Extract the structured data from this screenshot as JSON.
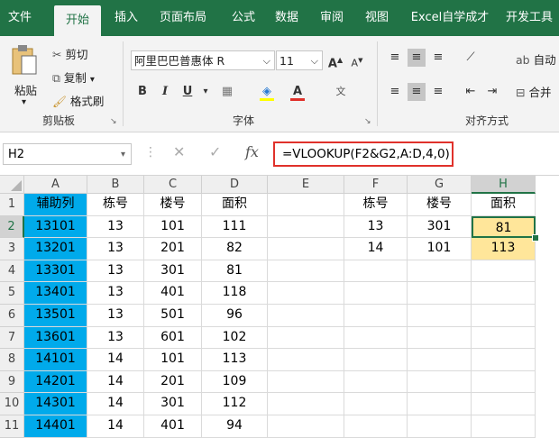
{
  "ribbon_tabs": [
    "文件",
    "开始",
    "插入",
    "页面布局",
    "公式",
    "数据",
    "审阅",
    "视图",
    "Excel自学成才",
    "开发工具"
  ],
  "active_tab": "开始",
  "clipboard": {
    "paste": "粘贴",
    "cut": "剪切",
    "copy": "复制",
    "format_painter": "格式刷",
    "group_label": "剪贴板"
  },
  "font": {
    "name": "阿里巴巴普惠体 R",
    "size": "11",
    "grow": "A",
    "shrink": "A",
    "bold": "B",
    "italic": "I",
    "underline": "U",
    "group_label": "字体"
  },
  "alignment": {
    "wrap_label": "自动",
    "merge_label": "合并",
    "group_label": "对齐方式"
  },
  "formula_bar": {
    "name_box": "H2",
    "fx": "fx",
    "formula": "=VLOOKUP(F2&G2,A:D,4,0)"
  },
  "sheet": {
    "columns": [
      "A",
      "B",
      "C",
      "D",
      "E",
      "F",
      "G",
      "H"
    ],
    "rows": [
      "1",
      "2",
      "3",
      "4",
      "5",
      "6",
      "7",
      "8",
      "9",
      "10",
      "11"
    ],
    "cells": [
      [
        "辅助列",
        "栋号",
        "楼号",
        "面积",
        "",
        "栋号",
        "楼号",
        "面积"
      ],
      [
        "13101",
        "13",
        "101",
        "111",
        "",
        "13",
        "301",
        "81"
      ],
      [
        "13201",
        "13",
        "201",
        "82",
        "",
        "14",
        "101",
        "113"
      ],
      [
        "13301",
        "13",
        "301",
        "81",
        "",
        "",
        "",
        ""
      ],
      [
        "13401",
        "13",
        "401",
        "118",
        "",
        "",
        "",
        ""
      ],
      [
        "13501",
        "13",
        "501",
        "96",
        "",
        "",
        "",
        ""
      ],
      [
        "13601",
        "13",
        "601",
        "102",
        "",
        "",
        "",
        ""
      ],
      [
        "14101",
        "14",
        "101",
        "113",
        "",
        "",
        "",
        ""
      ],
      [
        "14201",
        "14",
        "201",
        "109",
        "",
        "",
        "",
        ""
      ],
      [
        "14301",
        "14",
        "301",
        "112",
        "",
        "",
        "",
        ""
      ],
      [
        "14401",
        "14",
        "401",
        "94",
        "",
        "",
        "",
        ""
      ]
    ],
    "active_cell": "H2",
    "colors": {
      "helper_fill": "#00aaeb",
      "result_fill": "#ffe69a",
      "accent": "#217346",
      "formula_border": "#e0312b"
    }
  }
}
